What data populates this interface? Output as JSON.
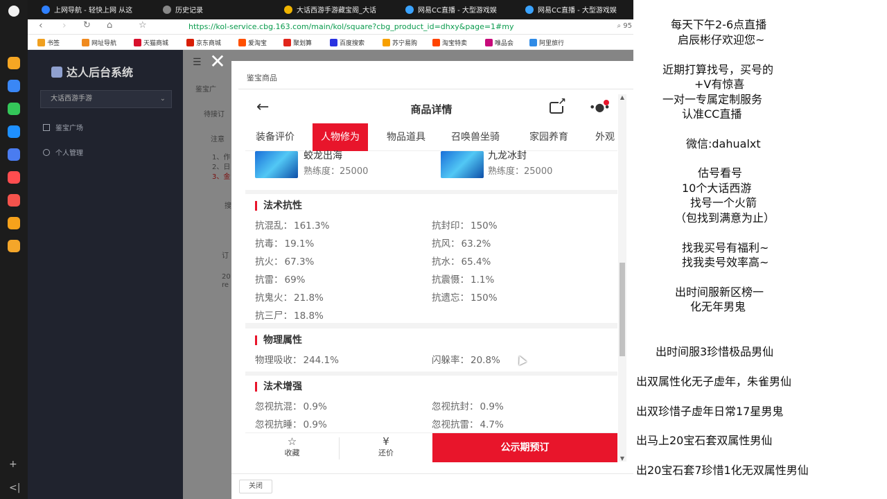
{
  "browser": {
    "tabs": [
      {
        "label": "上网导航 - 轻快上网 从这",
        "color": "#2f80ff"
      },
      {
        "label": "历史记录",
        "color": "#888888"
      },
      {
        "label": "大话西游手游藏宝阁_大话",
        "color": "#f0b400"
      },
      {
        "label": "网易CC直播 - 大型游戏娱",
        "color": "#3aa3ff"
      },
      {
        "label": "网易CC直播 - 大型游戏娱",
        "color": "#3aa3ff"
      }
    ],
    "url": "https://kol-service.cbg.163.com/main/kol/square?cbg_product_id=dhxy&page=1#my",
    "url_right": "95",
    "bookmarks": [
      {
        "label": "书签",
        "color": "#f0a020"
      },
      {
        "label": "网址导航",
        "color": "#f08a1e"
      },
      {
        "label": "天猫商城",
        "color": "#d8102c"
      },
      {
        "label": "京东商城",
        "color": "#d81e06"
      },
      {
        "label": "爱淘宝",
        "color": "#ff5000"
      },
      {
        "label": "聚划算",
        "color": "#e1251b"
      },
      {
        "label": "百度搜索",
        "color": "#2932e1"
      },
      {
        "label": "苏宁易购",
        "color": "#f7a000"
      },
      {
        "label": "淘宝特卖",
        "color": "#ff4400"
      },
      {
        "label": "唯品会",
        "color": "#c70a7a"
      },
      {
        "label": "阿里旅行",
        "color": "#2f8be6"
      }
    ]
  },
  "dashboard": {
    "title": "达人后台系统",
    "game_select": "大话西游手游",
    "nav": [
      "鉴宝广场",
      "个人管理"
    ],
    "bg_texts": [
      "鉴宝广",
      "待接订",
      "注意",
      "1、作",
      "2、日",
      "3、金",
      "搜",
      "订",
      "20",
      "re"
    ]
  },
  "dialog": {
    "title": "鉴宝商品",
    "close_label": "关闭"
  },
  "mobile": {
    "title": "商品详情",
    "tabs": [
      "装备评价",
      "人物修为",
      "物品道具",
      "召唤兽坐骑",
      "家园养育",
      "外观"
    ],
    "skills": [
      {
        "name": "蛟龙出海",
        "label": "熟练度：",
        "value": "25000"
      },
      {
        "name": "九龙冰封",
        "label": "熟练度：",
        "value": "25000"
      }
    ],
    "sections": [
      {
        "title": "法术抗性",
        "attrs": [
          {
            "label": "抗混乱：",
            "value": "161.3%"
          },
          {
            "label": "抗封印：",
            "value": "150%"
          },
          {
            "label": "抗毒：",
            "value": "19.1%"
          },
          {
            "label": "抗风：",
            "value": "63.2%"
          },
          {
            "label": "抗火：",
            "value": "67.3%"
          },
          {
            "label": "抗水：",
            "value": "65.4%"
          },
          {
            "label": "抗雷：",
            "value": "69%"
          },
          {
            "label": "抗震慑：",
            "value": "1.1%"
          },
          {
            "label": "抗鬼火：",
            "value": "21.8%"
          },
          {
            "label": "抗遗忘：",
            "value": "150%"
          },
          {
            "label": "抗三尸：",
            "value": "18.8%"
          }
        ]
      },
      {
        "title": "物理属性",
        "attrs": [
          {
            "label": "物理吸收：",
            "value": "244.1%"
          },
          {
            "label": "闪躲率：",
            "value": "20.8%"
          }
        ]
      },
      {
        "title": "法术增强",
        "attrs": [
          {
            "label": "忽视抗混：",
            "value": "0.9%"
          },
          {
            "label": "忽视抗封：",
            "value": "0.9%"
          },
          {
            "label": "忽视抗睡：",
            "value": "0.9%"
          },
          {
            "label": "忽视抗雷：",
            "value": "4.7%"
          }
        ]
      }
    ],
    "actions": {
      "collect": "收藏",
      "bargain": "还价",
      "buy": "公示期预订"
    }
  },
  "stream_panel": {
    "lines": [
      "每天下午2-6点直播",
      "启辰彬仔欢迎您~",
      "近期打算找号，买号的",
      "+V有惊喜",
      "一对一专属定制服务",
      "认准CC直播",
      "微信:dahualxt",
      "估号看号",
      "10个大话西游",
      "找号一个火箭",
      "（包找到满意为止）",
      "找我买号有福利~",
      "找我卖号效率高~",
      "出时间服新区榜一",
      "化无年男鬼",
      "出时间服3珍惜极品男仙",
      "出双属性化无子虚年，朱雀男仙",
      "出双珍惜子虚年日常17星男鬼",
      "出马上20宝石套双属性男仙",
      "出20宝石套7珍惜1化无双属性男仙"
    ]
  }
}
